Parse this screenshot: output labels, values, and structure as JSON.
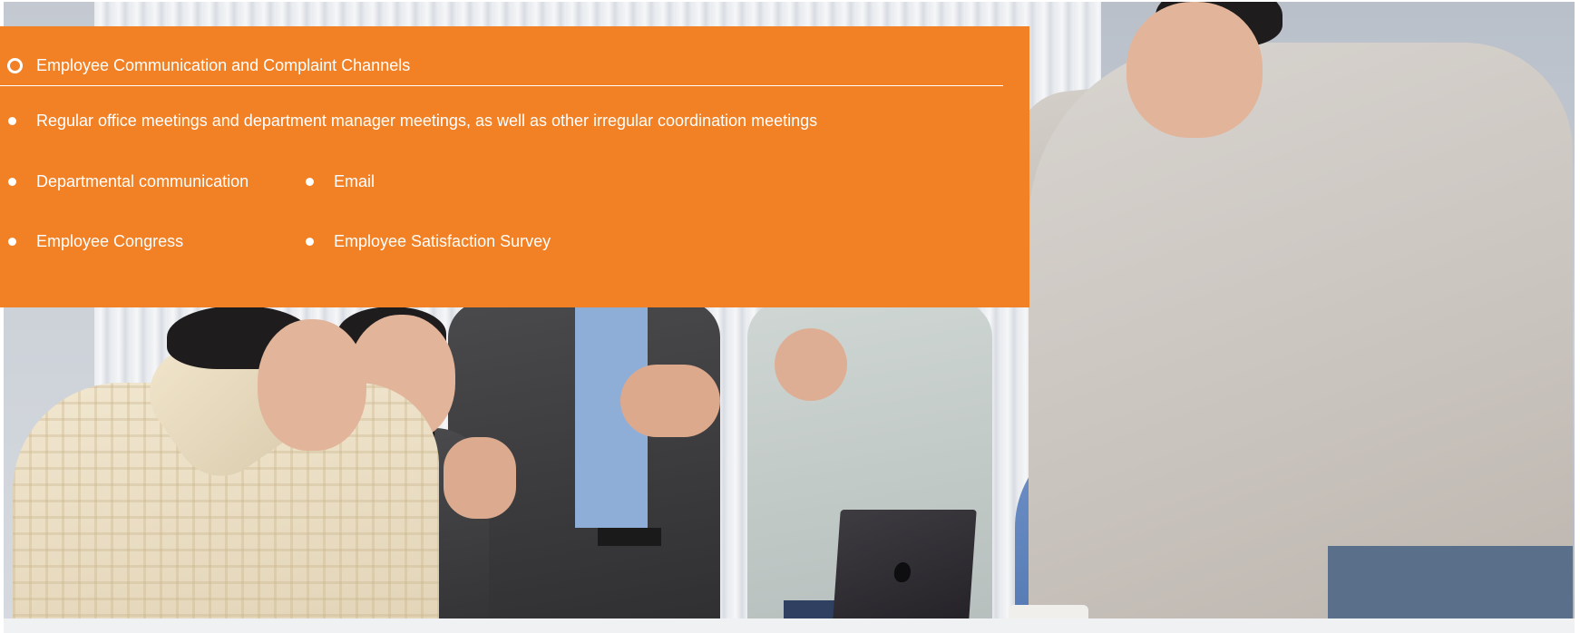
{
  "panel": {
    "background_color": "#f28025",
    "text_color": "#ffffff",
    "header_icon": "ring-icon",
    "title": "Employee Communication and Complaint Channels",
    "items": [
      {
        "label": "Regular office meetings and department manager meetings, as well as other irregular coordination meetings",
        "icon": "dot-icon"
      },
      {
        "label": "Departmental communication",
        "icon": "dot-icon"
      },
      {
        "label": "Email",
        "icon": "dot-icon"
      },
      {
        "label": "Employee Congress",
        "icon": "dot-icon"
      },
      {
        "label": "Employee Satisfaction Survey",
        "icon": "dot-icon"
      }
    ]
  }
}
